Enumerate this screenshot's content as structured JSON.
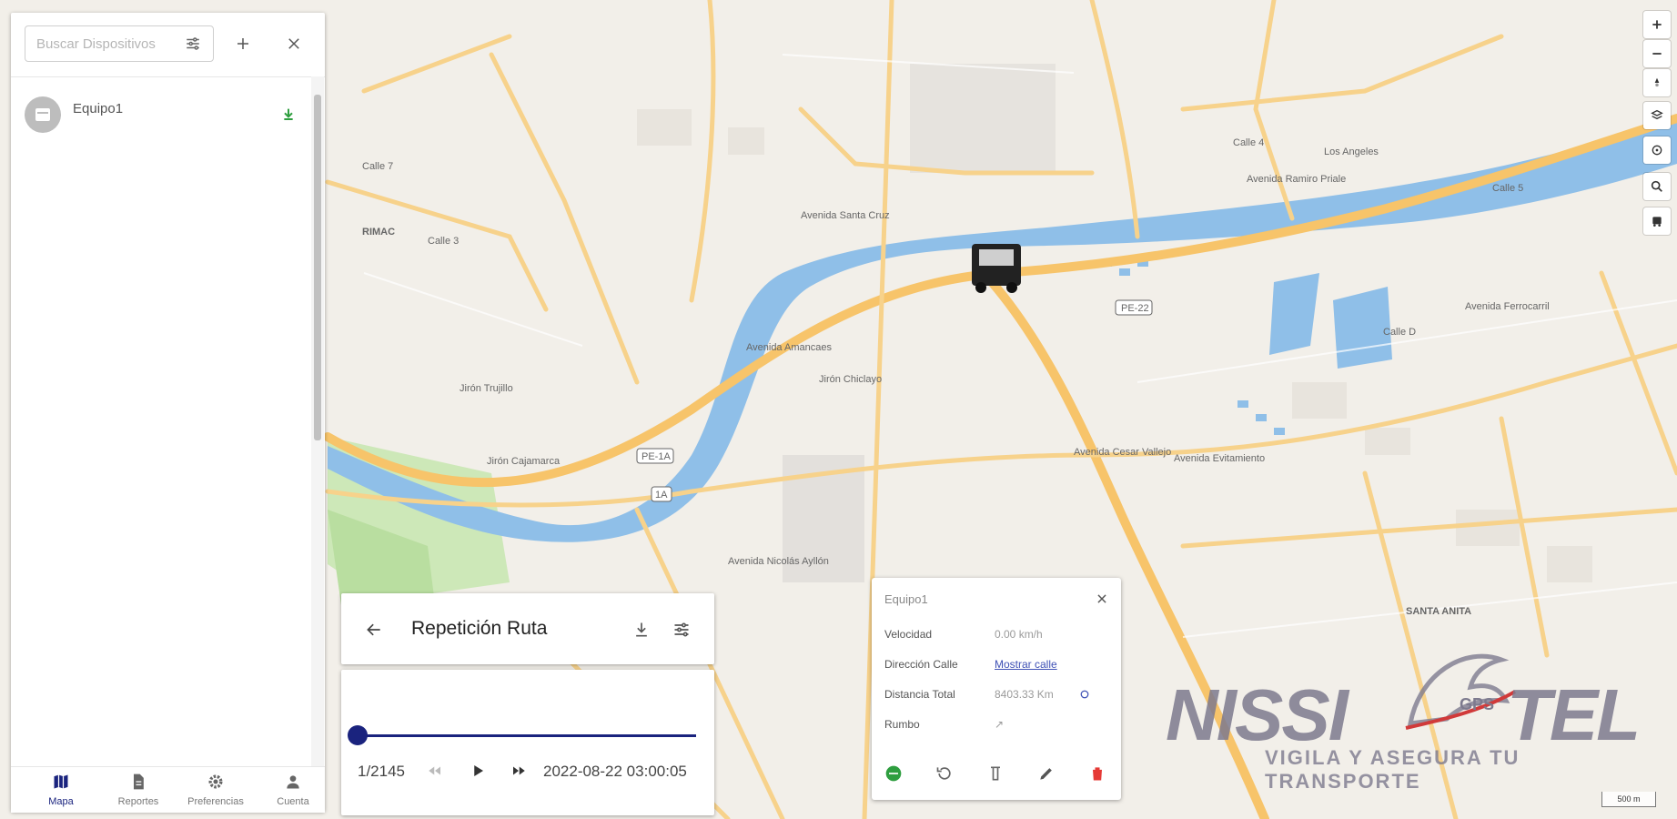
{
  "sidebar": {
    "search_placeholder": "Buscar Dispositivos",
    "devices": [
      {
        "name": "Equipo1",
        "status_icon": "arrow-down-icon",
        "status_color": "#2e9e3f"
      }
    ],
    "nav": [
      {
        "label": "Mapa",
        "icon": "map-icon",
        "active": true
      },
      {
        "label": "Reportes",
        "icon": "document-icon",
        "active": false
      },
      {
        "label": "Preferencias",
        "icon": "gear-icon",
        "active": false
      },
      {
        "label": "Cuenta",
        "icon": "person-icon",
        "active": false
      }
    ]
  },
  "replay": {
    "title": "Repetición Ruta",
    "position_text": "1/2145",
    "timestamp": "2022-08-22 03:00:05",
    "progress": 0.0
  },
  "popup": {
    "device_name": "Equipo1",
    "rows": [
      {
        "label": "Velocidad",
        "value": "0.00 km/h"
      },
      {
        "label": "Dirección Calle",
        "value": "Mostrar calle"
      },
      {
        "label": "Distancia Total",
        "value": "8403.33 Km"
      },
      {
        "label": "Rumbo",
        "value": "↗"
      }
    ],
    "actions": [
      "play-circle-icon",
      "replay-icon",
      "command-icon",
      "edit-icon",
      "delete-icon"
    ]
  },
  "map": {
    "labels": [
      "Calle 7",
      "RIMAC",
      "Calle 3",
      "Jirón Trujillo",
      "Avenida Santa Cruz",
      "Jirón Cajamarca",
      "Avenida Amancaes",
      "Jirón Chiclayo",
      "Avenida Ramiro Priale",
      "Calle 4",
      "Los Angeles",
      "Avenida Evitamiento",
      "Avenida Nicolás Ayllón",
      "Avenida Cesar Vallejo",
      "Calle D",
      "SANTA ANITA",
      "Calle 5",
      "Avenida Ferrocarril",
      "PE-1A",
      "PE-22",
      "1A"
    ],
    "scale": "500 m"
  },
  "brand": {
    "name": "NISSI",
    "suffix": "TEL",
    "gps": "GPS",
    "tagline": "VIGILA Y ASEGURA TU TRANSPORTE"
  },
  "colors": {
    "primary": "#1a237e",
    "online": "#2e9e3f",
    "delete": "#e53935",
    "road": "#f7d28b",
    "river": "#8fbfe8"
  }
}
